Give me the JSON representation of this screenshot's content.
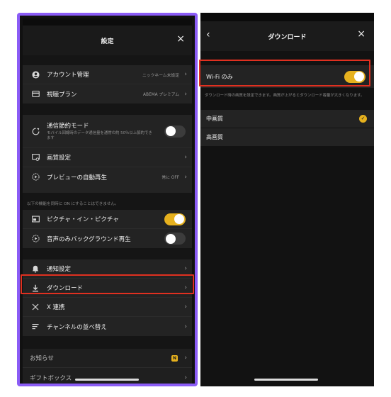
{
  "left": {
    "title": "設定",
    "close": "×",
    "account": {
      "label": "アカウント管理",
      "value": "ニックネーム未設定"
    },
    "plan": {
      "label": "視聴プラン",
      "value": "ABEMA プレミアム"
    },
    "data_saver": {
      "label": "通信節約モード",
      "desc": "モバイル回線時のデータ通信量を通常の約 50％以上節約できます"
    },
    "quality": {
      "label": "画質設定"
    },
    "preview": {
      "label": "プレビューの自動再生",
      "value": "常に OFF"
    },
    "note": "以下の機能を同時に ON にすることはできません。",
    "pip": {
      "label": "ピクチャ・イン・ピクチャ"
    },
    "bg_audio": {
      "label": "音声のみバックグラウンド再生"
    },
    "notify": {
      "label": "通知設定"
    },
    "download": {
      "label": "ダウンロード"
    },
    "x_link": {
      "label": "X 連携"
    },
    "channel_order": {
      "label": "チャンネルの並べ替え"
    },
    "news": {
      "label": "お知らせ",
      "badge": "N"
    },
    "gift": {
      "label": "ギフトボックス"
    },
    "chevron": "›"
  },
  "right": {
    "title": "ダウンロード",
    "back": "‹",
    "close": "×",
    "wifi_only": {
      "label": "Wi-Fi のみ"
    },
    "desc": "ダウンロード時の画質を設定できます。画質が上がるとダウンロード容量が大きくなります。",
    "options": [
      {
        "label": "中画質",
        "selected": true
      },
      {
        "label": "高画質",
        "selected": false
      }
    ],
    "check": "✓"
  },
  "colors": {
    "accent": "#e6b11e",
    "frame": "#8b5cf6",
    "highlight": "#e03020"
  }
}
